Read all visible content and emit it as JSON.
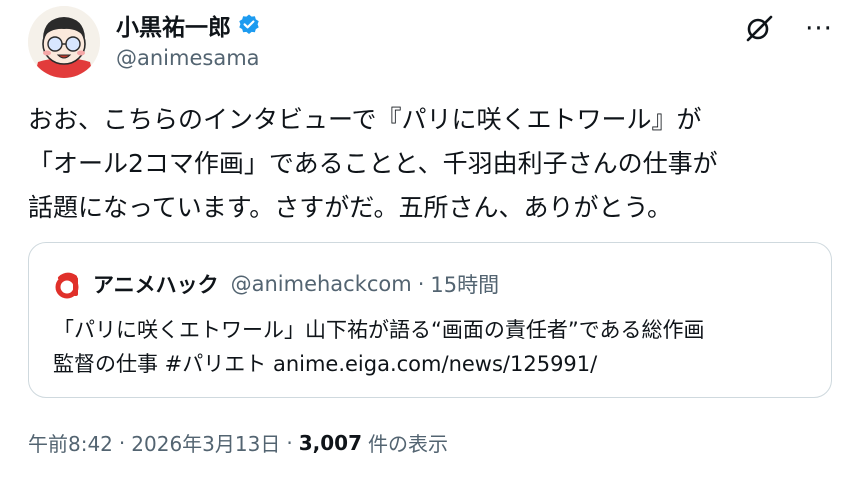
{
  "author": {
    "display_name": "小黒祐一郎",
    "handle": "@animesama",
    "avatar_icon": "cartoon-face-avatar",
    "verified_icon": "verified-badge-icon"
  },
  "actions": {
    "grok_icon": "grok-icon",
    "more_label": "···"
  },
  "tweet": {
    "lines": [
      "おお、こちらのインタビューで『パリに咲くエトワール』が",
      "「オール2コマ作画」であることと、千羽由利子さんの仕事が",
      "話題になっています。さすがだ。五所さん、ありがとう。"
    ]
  },
  "quote": {
    "logo_icon": "animehack-logo-icon",
    "name": "アニメハック",
    "handle": "@animehackcom",
    "dot": "·",
    "time": "15時間",
    "lines": [
      "「パリに咲くエトワール」山下祐が語る“画面の責任者”である総作画",
      "監督の仕事 #パリエト anime.eiga.com/news/125991/"
    ]
  },
  "footer": {
    "time": "午前8:42",
    "dot1": "·",
    "date": "2026年3月13日",
    "dot2": "·",
    "views_count": "3,007",
    "views_label": "件の表示"
  },
  "colors": {
    "text": "#0f1419",
    "secondary": "#536471",
    "border": "#cfd9de",
    "verified": "#1d9bf0",
    "logo_red": "#e0302a"
  }
}
